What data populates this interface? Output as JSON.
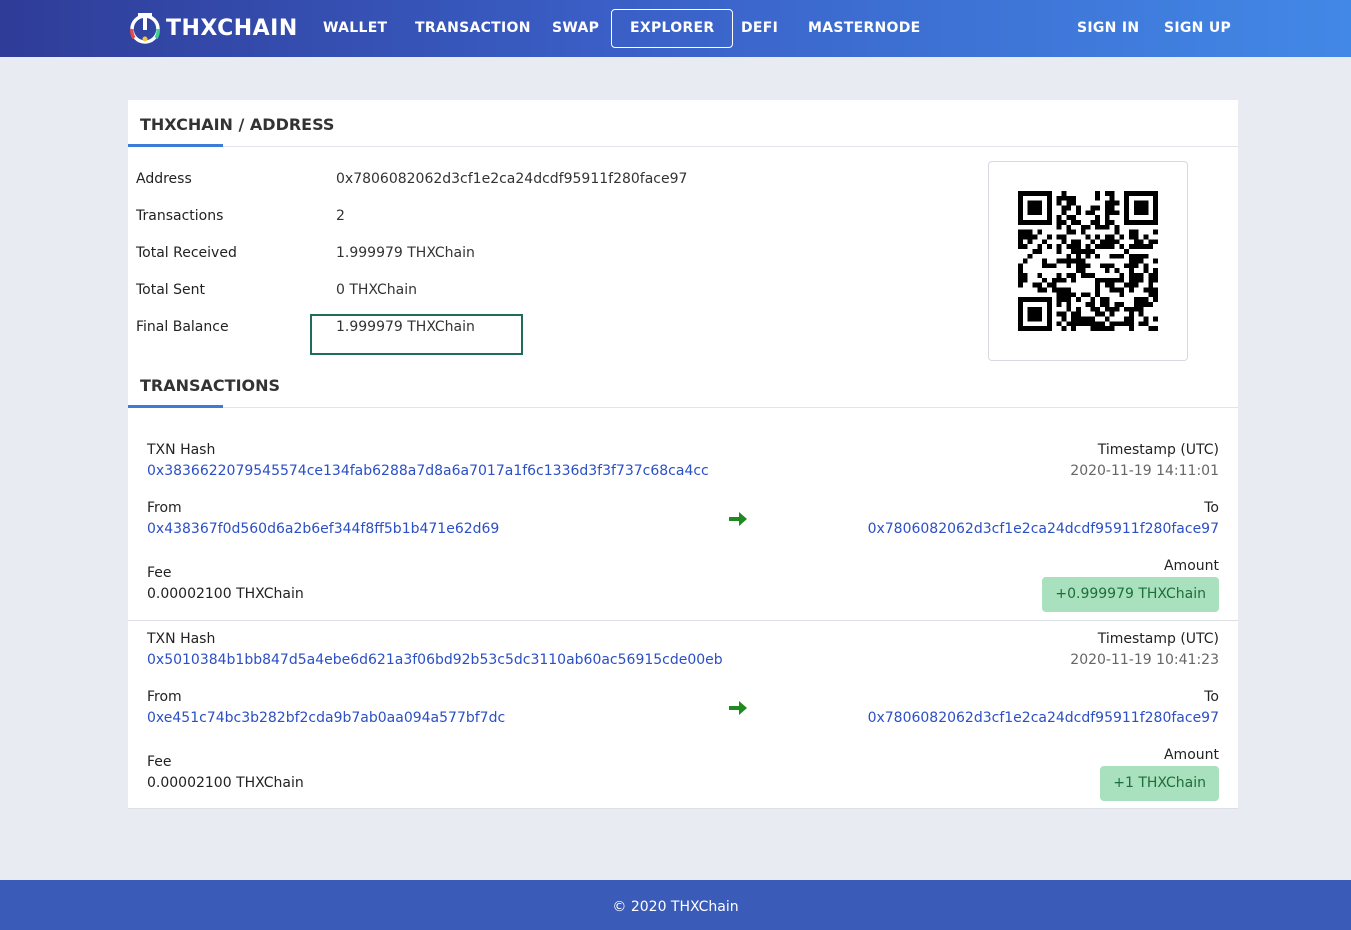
{
  "header": {
    "logo_text": "THXCHAIN",
    "nav": [
      "WALLET",
      "TRANSACTION",
      "SWAP",
      "EXPLORER",
      "DEFI",
      "MASTERNODE"
    ],
    "active_nav": "EXPLORER",
    "sign_in": "SIGN IN",
    "sign_up": "SIGN UP"
  },
  "address_section": {
    "title": "THXCHAIN / ADDRESS",
    "rows": [
      {
        "label": "Address",
        "value": "0x7806082062d3cf1e2ca24dcdf95911f280face97"
      },
      {
        "label": "Transactions",
        "value": "2"
      },
      {
        "label": "Total Received",
        "value": "1.999979 THXChain"
      },
      {
        "label": "Total Sent",
        "value": "0 THXChain"
      },
      {
        "label": "Final Balance",
        "value": "1.999979 THXChain"
      }
    ]
  },
  "transactions_section": {
    "title": "TRANSACTIONS",
    "labels": {
      "hash": "TXN Hash",
      "timestamp": "Timestamp (UTC)",
      "from": "From",
      "to": "To",
      "fee": "Fee",
      "amount": "Amount"
    },
    "items": [
      {
        "hash": "0x3836622079545574ce134fab6288a7d8a6a7017a1f6c1336d3f3f737c68ca4cc",
        "timestamp": "2020-11-19 14:11:01",
        "from": "0x438367f0d560d6a2b6ef344f8ff5b1b471e62d69",
        "to": "0x7806082062d3cf1e2ca24dcdf95911f280face97",
        "fee": "0.00002100 THXChain",
        "amount": "+0.999979 THXChain"
      },
      {
        "hash": "0x5010384b1bb847d5a4ebe6d621a3f06bd92b53c5dc3110ab60ac56915cde00eb",
        "timestamp": "2020-11-19 10:41:23",
        "from": "0xe451c74bc3b282bf2cda9b7ab0aa094a577bf7dc",
        "to": "0x7806082062d3cf1e2ca24dcdf95911f280face97",
        "fee": "0.00002100 THXChain",
        "amount": "+1 THXChain"
      }
    ]
  },
  "footer": {
    "text": "© 2020 THXChain"
  },
  "colors": {
    "accent": "#3d7bd9",
    "link": "#2b4fc5",
    "arrow": "#1f8a1f",
    "amount_bg": "#a9e0bd"
  }
}
